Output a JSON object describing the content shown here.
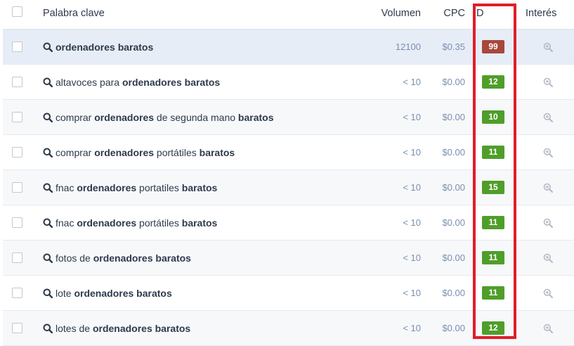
{
  "columns": {
    "keyword": "Palabra clave",
    "volume": "Volumen",
    "cpc": "CPC",
    "id": "ID",
    "interest": "Interés"
  },
  "colors": {
    "badge_red": "#a8473c",
    "badge_green": "#4f9e2a",
    "highlight": "#e11d2a",
    "selected_row": "#e6edf7"
  },
  "rows": [
    {
      "parts": [
        {
          "t": "ordenadores baratos",
          "b": true
        }
      ],
      "volume": "12100",
      "cpc": "$0.35",
      "id": "99",
      "id_color": "red",
      "selected": true
    },
    {
      "parts": [
        {
          "t": "altavoces para ",
          "b": false
        },
        {
          "t": "ordenadores baratos",
          "b": true
        }
      ],
      "volume": "< 10",
      "cpc": "$0.00",
      "id": "12",
      "id_color": "green",
      "selected": false
    },
    {
      "parts": [
        {
          "t": "comprar ",
          "b": false
        },
        {
          "t": "ordenadores",
          "b": true
        },
        {
          "t": " de segunda mano ",
          "b": false
        },
        {
          "t": "baratos",
          "b": true
        }
      ],
      "volume": "< 10",
      "cpc": "$0.00",
      "id": "10",
      "id_color": "green",
      "selected": false
    },
    {
      "parts": [
        {
          "t": "comprar ",
          "b": false
        },
        {
          "t": "ordenadores",
          "b": true
        },
        {
          "t": " portátiles ",
          "b": false
        },
        {
          "t": "baratos",
          "b": true
        }
      ],
      "volume": "< 10",
      "cpc": "$0.00",
      "id": "11",
      "id_color": "green",
      "selected": false
    },
    {
      "parts": [
        {
          "t": "fnac ",
          "b": false
        },
        {
          "t": "ordenadores",
          "b": true
        },
        {
          "t": " portatiles ",
          "b": false
        },
        {
          "t": "baratos",
          "b": true
        }
      ],
      "volume": "< 10",
      "cpc": "$0.00",
      "id": "15",
      "id_color": "green",
      "selected": false
    },
    {
      "parts": [
        {
          "t": "fnac ",
          "b": false
        },
        {
          "t": "ordenadores",
          "b": true
        },
        {
          "t": " portátiles ",
          "b": false
        },
        {
          "t": "baratos",
          "b": true
        }
      ],
      "volume": "< 10",
      "cpc": "$0.00",
      "id": "11",
      "id_color": "green",
      "selected": false
    },
    {
      "parts": [
        {
          "t": "fotos de ",
          "b": false
        },
        {
          "t": "ordenadores baratos",
          "b": true
        }
      ],
      "volume": "< 10",
      "cpc": "$0.00",
      "id": "11",
      "id_color": "green",
      "selected": false
    },
    {
      "parts": [
        {
          "t": "lote ",
          "b": false
        },
        {
          "t": "ordenadores baratos",
          "b": true
        }
      ],
      "volume": "< 10",
      "cpc": "$0.00",
      "id": "11",
      "id_color": "green",
      "selected": false
    },
    {
      "parts": [
        {
          "t": "lotes de ",
          "b": false
        },
        {
          "t": "ordenadores baratos",
          "b": true
        }
      ],
      "volume": "< 10",
      "cpc": "$0.00",
      "id": "12",
      "id_color": "green",
      "selected": false
    }
  ]
}
